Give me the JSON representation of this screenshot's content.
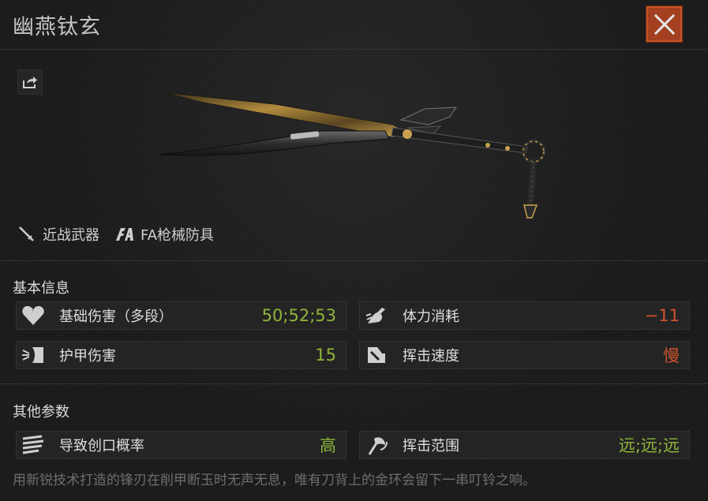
{
  "title": "幽燕钛玄",
  "tags": [
    {
      "icon": "melee-weapon-icon",
      "label": "近战武器"
    },
    {
      "icon": "fa-brand-icon",
      "label": "FA枪械防具"
    }
  ],
  "basic_info": {
    "heading": "基本信息",
    "stats": [
      {
        "icon": "broken-heart-icon",
        "label": "基础伤害（多段）",
        "value": "50;52;53",
        "color": "#8fb63a"
      },
      {
        "icon": "stamina-icon",
        "label": "体力消耗",
        "value": "−11",
        "color": "#d0532c"
      },
      {
        "icon": "armor-damage-icon",
        "label": "护甲伤害",
        "value": "15",
        "color": "#8fb63a"
      },
      {
        "icon": "swing-speed-icon",
        "label": "挥击速度",
        "value": "慢",
        "color": "#d0532c"
      }
    ]
  },
  "other_params": {
    "heading": "其他参数",
    "stats": [
      {
        "icon": "bleed-chance-icon",
        "label": "导致创口概率",
        "value": "高",
        "color": "#8fb63a"
      },
      {
        "icon": "axe-range-icon",
        "label": "挥击范围",
        "value": "远;远;远",
        "color": "#8fb63a"
      }
    ]
  },
  "description": "用新锐技术打造的锋刃在削甲断玉时无声无息，唯有刀背上的金环会留下一串叮铃之响。",
  "colors": {
    "accent": "#a3401f",
    "positive": "#8fb63a",
    "negative": "#d0532c"
  }
}
